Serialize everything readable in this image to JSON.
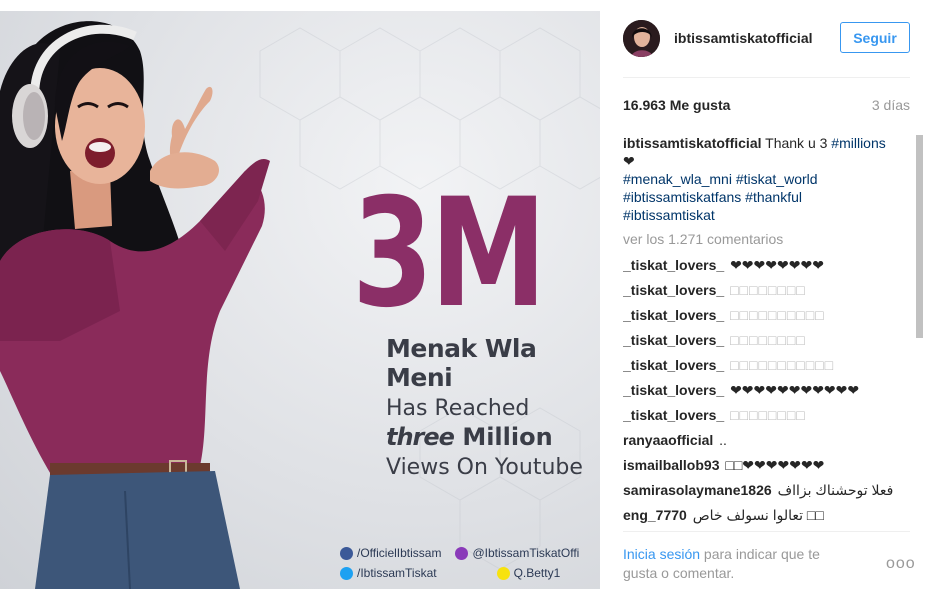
{
  "post_image": {
    "headline": "3M",
    "song": "Menak Wla Meni",
    "line2": "Has Reached",
    "line3_bold": "three",
    "line3_rest": "Million",
    "line4": "Views On Youtube",
    "socials": [
      {
        "icon": "facebook-icon",
        "text": "/OfficielIbtissam"
      },
      {
        "icon": "instagram-icon",
        "text": "@IbtissamTiskatOffi"
      },
      {
        "icon": "twitter-icon",
        "text": "/IbtissamTiskat"
      },
      {
        "icon": "snapchat-icon",
        "text": "Q.Betty1"
      }
    ]
  },
  "header": {
    "username": "ibtissamtiskatofficial",
    "follow_label": "Seguir"
  },
  "stats": {
    "likes": "16.963 Me gusta",
    "time": "3 días"
  },
  "caption": {
    "author": "ibtissamtiskatofficial",
    "text_before": "Thank u 3",
    "hashtags_line1": [
      "#millions"
    ],
    "heart": "❤",
    "hashtags_line2": [
      "#menak_wla_mni",
      "#tiskat_world"
    ],
    "hashtags_line3": [
      "#ibtissamtiskatfans",
      "#thankful"
    ],
    "hashtags_line4": [
      "#ibtissamtiskat"
    ]
  },
  "view_all": "ver los 1.271 comentarios",
  "comments": [
    {
      "author": "_tiskat_lovers_",
      "text": "❤❤❤❤❤❤❤❤",
      "style": "heart"
    },
    {
      "author": "_tiskat_lovers_",
      "text": "□□□□□□□□",
      "style": "box"
    },
    {
      "author": "_tiskat_lovers_",
      "text": "□□□□□□□□□□",
      "style": "box"
    },
    {
      "author": "_tiskat_lovers_",
      "text": "□□□□□□□□",
      "style": "box"
    },
    {
      "author": "_tiskat_lovers_",
      "text": "□□□□□□□□□□□",
      "style": "box"
    },
    {
      "author": "_tiskat_lovers_",
      "text": "❤❤❤❤❤❤❤❤❤❤❤",
      "style": "heart"
    },
    {
      "author": "_tiskat_lovers_",
      "text": "□□□□□□□□",
      "style": "box"
    },
    {
      "author": "ranyaaofficial",
      "text": "..",
      "style": "plain"
    },
    {
      "author": "ismailballob93",
      "text": "□□❤❤❤❤❤❤❤",
      "style": "mixed"
    },
    {
      "author": "samirasolaymane1826",
      "text": "فعلا توحشناك بزااف",
      "style": "plain"
    },
    {
      "author": "eng_7770",
      "text": "تعالوا نسولف خاص □□",
      "style": "plain"
    }
  ],
  "footer": {
    "login": "Inicia sesión",
    "rest": " para indicar que te gusta o comentar.",
    "more": "ooo"
  },
  "colors": {
    "accent": "#3897f0",
    "brand_purple": "#8b2f67",
    "hashtag": "#003569",
    "muted": "#999999"
  }
}
